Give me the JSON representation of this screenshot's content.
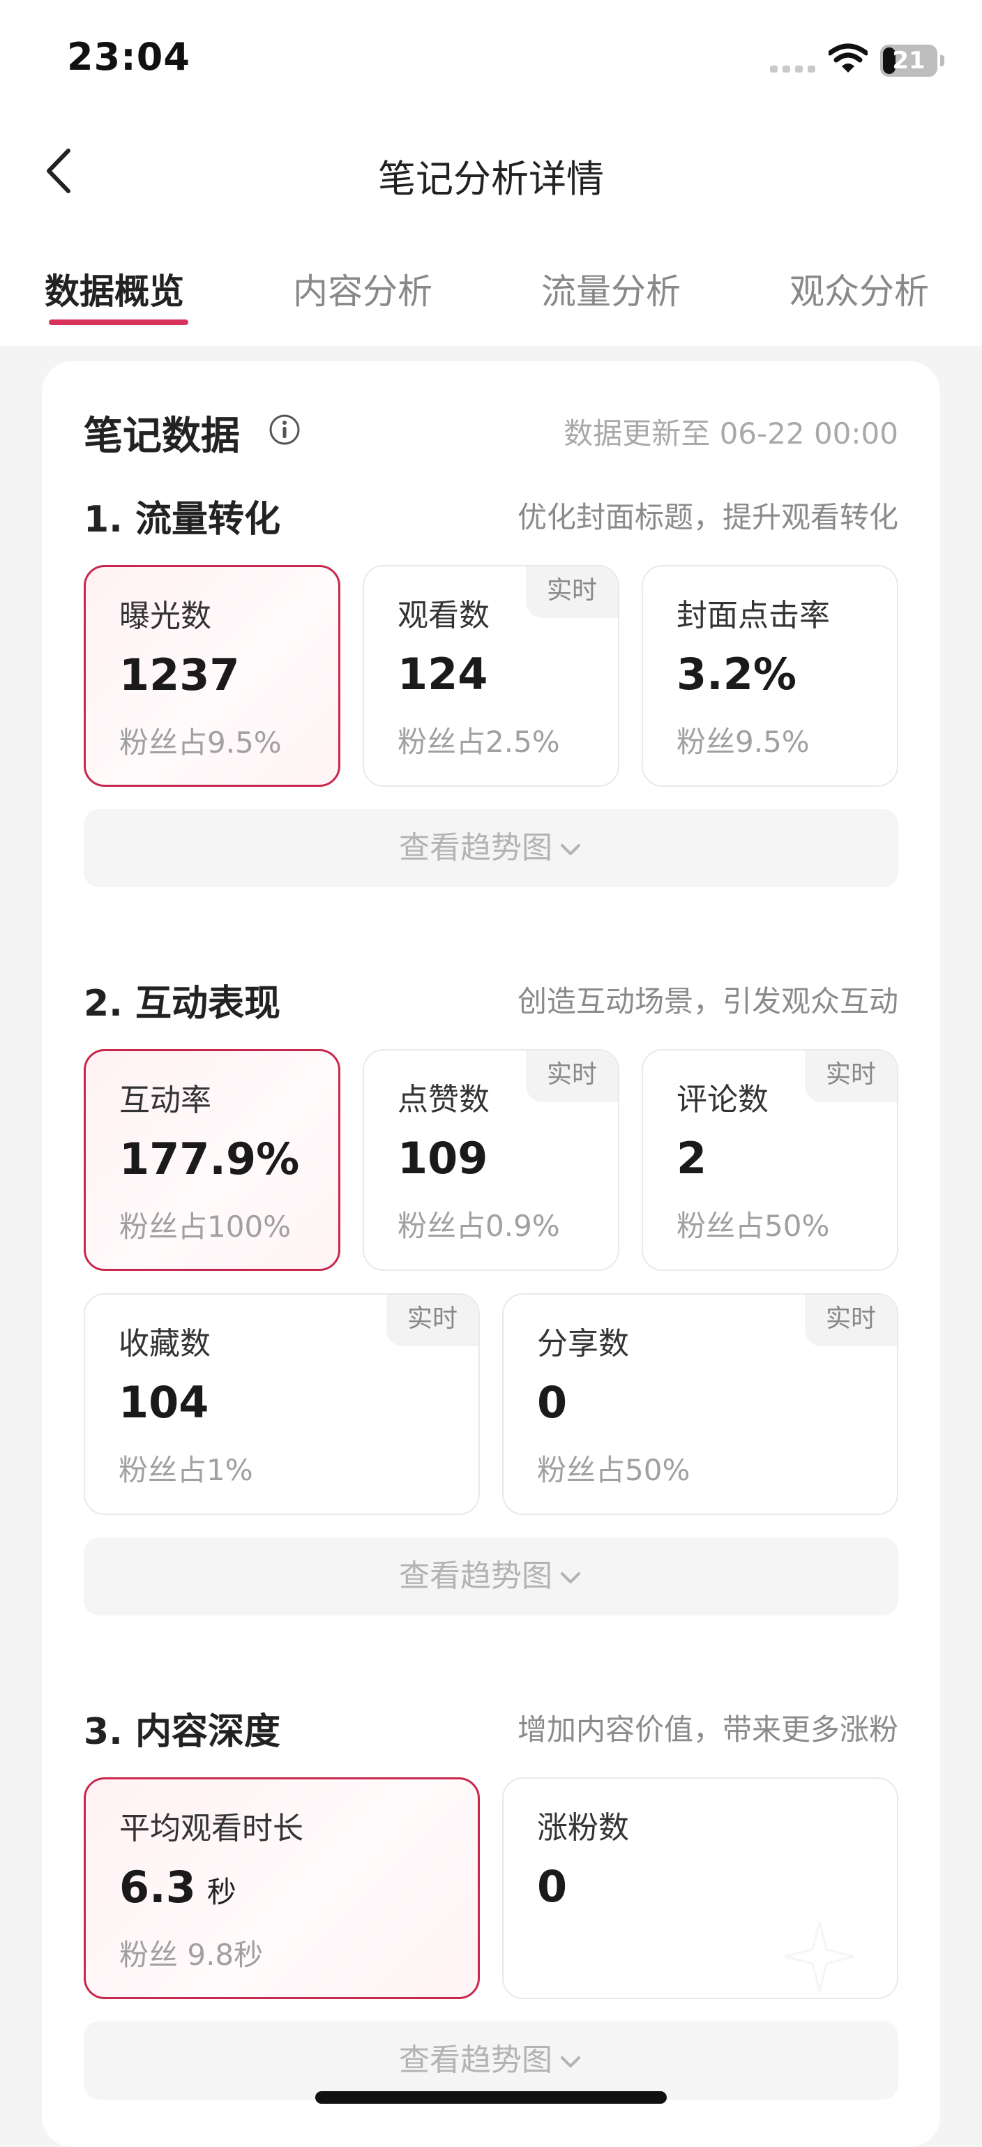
{
  "status_bar": {
    "time": "23:04",
    "battery_level": "21"
  },
  "nav": {
    "title": "笔记分析详情",
    "back_icon": "chevron-left-icon"
  },
  "tabs": [
    {
      "label": "数据概览",
      "active": true
    },
    {
      "label": "内容分析",
      "active": false
    },
    {
      "label": "流量分析",
      "active": false
    },
    {
      "label": "观众分析",
      "active": false
    }
  ],
  "notes": {
    "title": "笔记数据",
    "update_text": "数据更新至 06-22 00:00"
  },
  "sections": [
    {
      "title": "1. 流量转化",
      "hint": "优化封面标题，提升观看转化",
      "metrics": [
        {
          "label": "曝光数",
          "value": "1237",
          "sub": "粉丝占9.5%",
          "badge": "",
          "highlight": true
        },
        {
          "label": "观看数",
          "value": "124",
          "sub": "粉丝占2.5%",
          "badge": "实时",
          "highlight": false
        },
        {
          "label": "封面点击率",
          "value": "3.2%",
          "sub": "粉丝9.5%",
          "badge": "",
          "highlight": false
        }
      ],
      "trend_label": "查看趋势图"
    },
    {
      "title": "2. 互动表现",
      "hint": "创造互动场景，引发观众互动",
      "metrics": [
        {
          "label": "互动率",
          "value": "177.9%",
          "sub": "粉丝占100%",
          "badge": "",
          "highlight": true
        },
        {
          "label": "点赞数",
          "value": "109",
          "sub": "粉丝占0.9%",
          "badge": "实时",
          "highlight": false
        },
        {
          "label": "评论数",
          "value": "2",
          "sub": "粉丝占50%",
          "badge": "实时",
          "highlight": false
        },
        {
          "label": "收藏数",
          "value": "104",
          "sub": "粉丝占1%",
          "badge": "实时",
          "highlight": false
        },
        {
          "label": "分享数",
          "value": "0",
          "sub": "粉丝占50%",
          "badge": "实时",
          "highlight": false
        }
      ],
      "trend_label": "查看趋势图"
    },
    {
      "title": "3. 内容深度",
      "hint": "增加内容价值，带来更多涨粉",
      "metrics": [
        {
          "label": "平均观看时长",
          "value": "6.3",
          "unit": "秒",
          "sub": "粉丝 9.8秒",
          "badge": "",
          "highlight": true
        },
        {
          "label": "涨粉数",
          "value": "0",
          "sub": "",
          "badge": "",
          "highlight": false
        }
      ],
      "trend_label": "查看趋势图"
    }
  ],
  "colors": {
    "accent": "#d8335a",
    "highlight_border": "#c8284d",
    "background": "#f4f4f4"
  }
}
